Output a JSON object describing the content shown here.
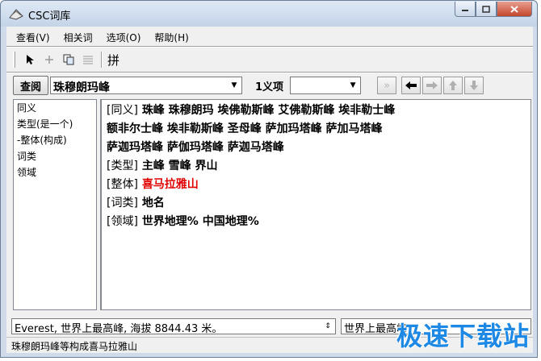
{
  "window": {
    "title": "CSC词库",
    "colors": {
      "highlight": "#e00000",
      "watermark": "#1e88e5"
    }
  },
  "menu": [
    "查看(V)",
    "相关词",
    "选项(O)",
    "帮助(H)"
  ],
  "toolbar": {
    "icons": [
      "pointer-icon",
      "plus-icon",
      "copy-icon",
      "list-icon"
    ],
    "pin_label": "拼"
  },
  "search": {
    "lookup_label": "查阅",
    "query": "珠穆朗玛峰",
    "syn_label": "1义项",
    "syn_value": ""
  },
  "left_panel": {
    "items": [
      "同义",
      "类型(是一个)",
      "-整体(构成)",
      "词类",
      "领域"
    ]
  },
  "details": {
    "syn_tag": "[同义]",
    "syn_line1": "珠峰 珠穆朗玛 埃佛勒斯峰 艾佛勒斯峰 埃非勒士峰",
    "syn_line2": "额非尔士峰 埃非勒斯峰 圣母峰 萨加玛塔峰 萨加马塔峰",
    "syn_line3": "萨迦玛塔峰 萨伽玛塔峰 萨迦马塔峰",
    "type_tag": "[类型]",
    "type_value": "主峰 雪峰 界山",
    "whole_tag": "[整体]",
    "whole_value": "喜马拉雅山",
    "pos_tag": "[词类]",
    "pos_value": "地名",
    "domain_tag": "[领域]",
    "domain_value": "世界地理% 中国地理%"
  },
  "definition": {
    "text": "Everest, 世界上最高峰, 海拔 8844.43 米。",
    "text2": "世界上最高峰"
  },
  "status": {
    "text": "珠穆朗玛峰等构成喜马拉雅山"
  },
  "watermark": "极速下载站"
}
